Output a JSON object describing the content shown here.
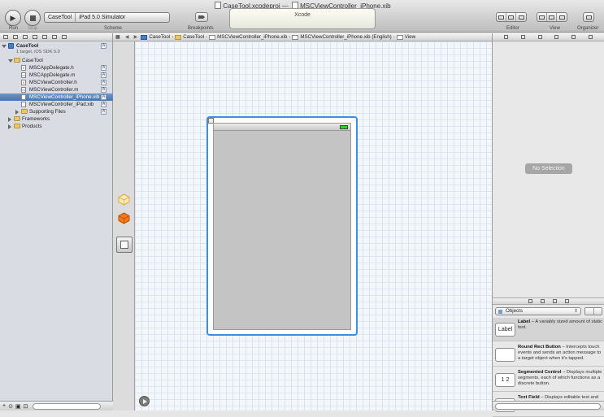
{
  "window": {
    "title_project": "CaseTool.xcodeproj",
    "title_sep": "—",
    "title_file": "MSCViewController_iPhone.xib"
  },
  "toolbar": {
    "run_label": "Run",
    "stop_label": "Stop",
    "scheme_label": "Scheme",
    "scheme_target": "CaseTool",
    "scheme_destination": "iPad 5.0 Simulator",
    "breakpoints_label": "Breakpoints",
    "activity_text": "Xcode",
    "editor_label": "Editor",
    "view_label": "View",
    "organizer_label": "Organizer"
  },
  "navigator": {
    "project_name": "CaseTool",
    "project_sub": "1 target, iOS SDK 5.0",
    "items": [
      {
        "label": "CaseTool",
        "kind": "folder",
        "indent": 1,
        "open": true
      },
      {
        "label": "MSCAppDelegate.h",
        "kind": "h",
        "indent": 2,
        "badge": "A"
      },
      {
        "label": "MSCAppDelegate.m",
        "kind": "m",
        "indent": 2,
        "badge": "A"
      },
      {
        "label": "MSCViewController.h",
        "kind": "h",
        "indent": 2,
        "badge": "A"
      },
      {
        "label": "MSCViewController.m",
        "kind": "m",
        "indent": 2,
        "badge": "A"
      },
      {
        "label": "MSCViewController_iPhone.xib",
        "kind": "xib",
        "indent": 2,
        "badge": "A",
        "selected": true
      },
      {
        "label": "MSCViewController_iPad.xib",
        "kind": "xib",
        "indent": 2,
        "badge": "A"
      },
      {
        "label": "Supporting Files",
        "kind": "folder",
        "indent": 2,
        "open": false,
        "badge": "A"
      },
      {
        "label": "Frameworks",
        "kind": "folder",
        "indent": 1,
        "open": false
      },
      {
        "label": "Products",
        "kind": "folder",
        "indent": 1,
        "open": false
      }
    ],
    "project_badge": "A"
  },
  "jumpbar": {
    "items": [
      "CaseTool",
      "CaseTool",
      "MSCViewController_iPhone.xib",
      "MSCViewController_iPhone.xib (English)",
      "View"
    ]
  },
  "inspector": {
    "no_selection": "No Selection"
  },
  "library": {
    "selector": "Objects",
    "items": [
      {
        "icon_text": "Label",
        "title": "Label",
        "desc": " – A variably sized amount of static text."
      },
      {
        "icon_text": "",
        "title": "Round Rect Button",
        "desc": " – Intercepts touch events and sends an action message to a target object when it's tapped."
      },
      {
        "icon_text": "1 2",
        "title": "Segmented Control",
        "desc": " – Displays multiple segments, each of which functions as a discrete button."
      },
      {
        "icon_text": "Text",
        "title": "Text Field",
        "desc": " – Displays editable text and sends an action message to a target"
      }
    ]
  }
}
